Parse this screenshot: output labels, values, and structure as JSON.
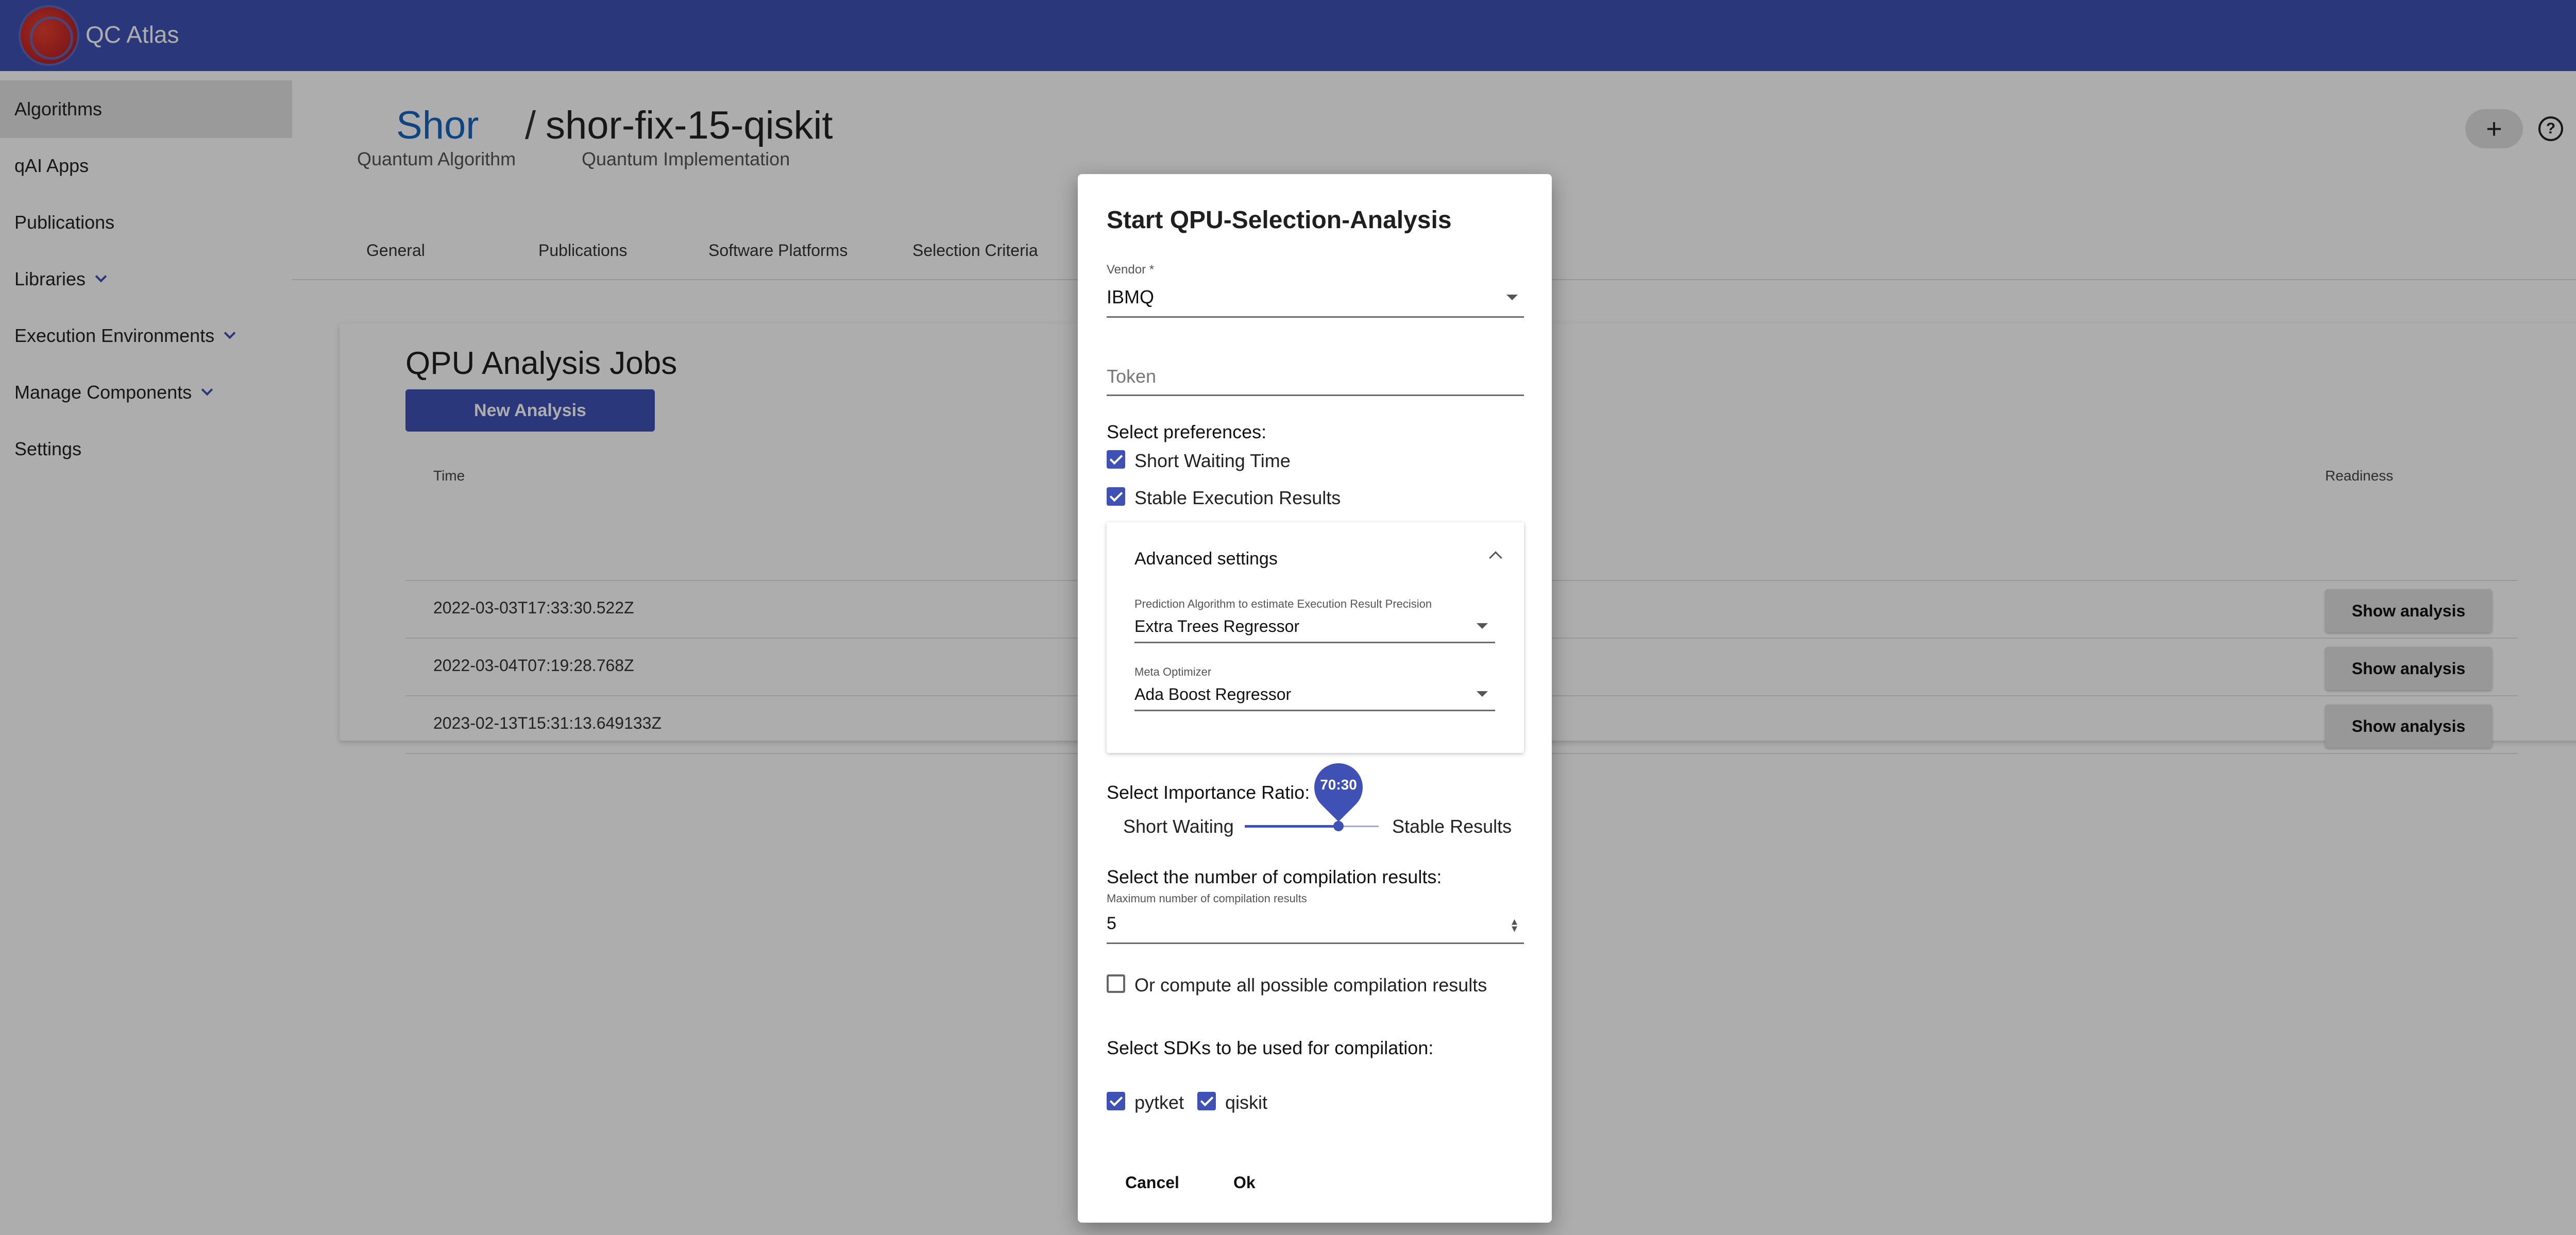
{
  "app": {
    "title": "QC Atlas"
  },
  "sidebar": {
    "items": [
      {
        "label": "Algorithms"
      },
      {
        "label": "qAI Apps"
      },
      {
        "label": "Publications"
      },
      {
        "label": "Libraries"
      },
      {
        "label": "Execution Environments"
      },
      {
        "label": "Manage Components"
      },
      {
        "label": "Settings"
      }
    ]
  },
  "breadcrumb": {
    "algorithm": "Shor",
    "algorithm_type": "Quantum Algorithm",
    "separator": "/",
    "implementation": "shor-fix-15-qiskit",
    "implementation_type": "Quantum Implementation"
  },
  "header_actions": {
    "add": "+",
    "help": "?"
  },
  "tabs": [
    {
      "label": "General"
    },
    {
      "label": "Publications"
    },
    {
      "label": "Software Platforms"
    },
    {
      "label": "Selection Criteria"
    }
  ],
  "jobs": {
    "title": "QPU Analysis Jobs",
    "new_button": "New Analysis",
    "col_time": "Time",
    "col_readiness": "Readiness",
    "rows": [
      {
        "time": "2022-03-03T17:33:30.522Z",
        "action": "Show analysis"
      },
      {
        "time": "2022-03-04T07:19:28.768Z",
        "action": "Show analysis"
      },
      {
        "time": "2023-02-13T15:31:13.649133Z",
        "action": "Show analysis"
      }
    ]
  },
  "dialog": {
    "title": "Start QPU-Selection-Analysis",
    "vendor_label": "Vendor *",
    "vendor_value": "IBMQ",
    "token_placeholder": "Token",
    "preferences_label": "Select preferences:",
    "pref_short_waiting": "Short Waiting Time",
    "pref_short_waiting_checked": true,
    "pref_stable": "Stable Execution Results",
    "pref_stable_checked": true,
    "advanced": {
      "title": "Advanced settings",
      "prediction_label": "Prediction Algorithm to estimate Execution Result Precision",
      "prediction_value": "Extra Trees Regressor",
      "meta_label": "Meta Optimizer",
      "meta_value": "Ada Boost Regressor"
    },
    "importance_label": "Select Importance Ratio:",
    "ratio_value": "70:30",
    "ratio_fraction": 0.7,
    "ratio_left": "Short Waiting",
    "ratio_right": "Stable Results",
    "compilation_label": "Select the number of compilation results:",
    "max_label": "Maximum number of compilation results",
    "max_value": "5",
    "compute_all": "Or compute all possible compilation results",
    "compute_all_checked": false,
    "sdk_label": "Select SDKs to be used for compilation:",
    "sdks": [
      {
        "label": "pytket",
        "checked": true
      },
      {
        "label": "qiskit",
        "checked": true
      }
    ],
    "cancel": "Cancel",
    "ok": "Ok"
  },
  "colors": {
    "primary": "#3f51b5",
    "link": "#1565c0",
    "overlay": "rgba(0,0,0,0.32)"
  }
}
